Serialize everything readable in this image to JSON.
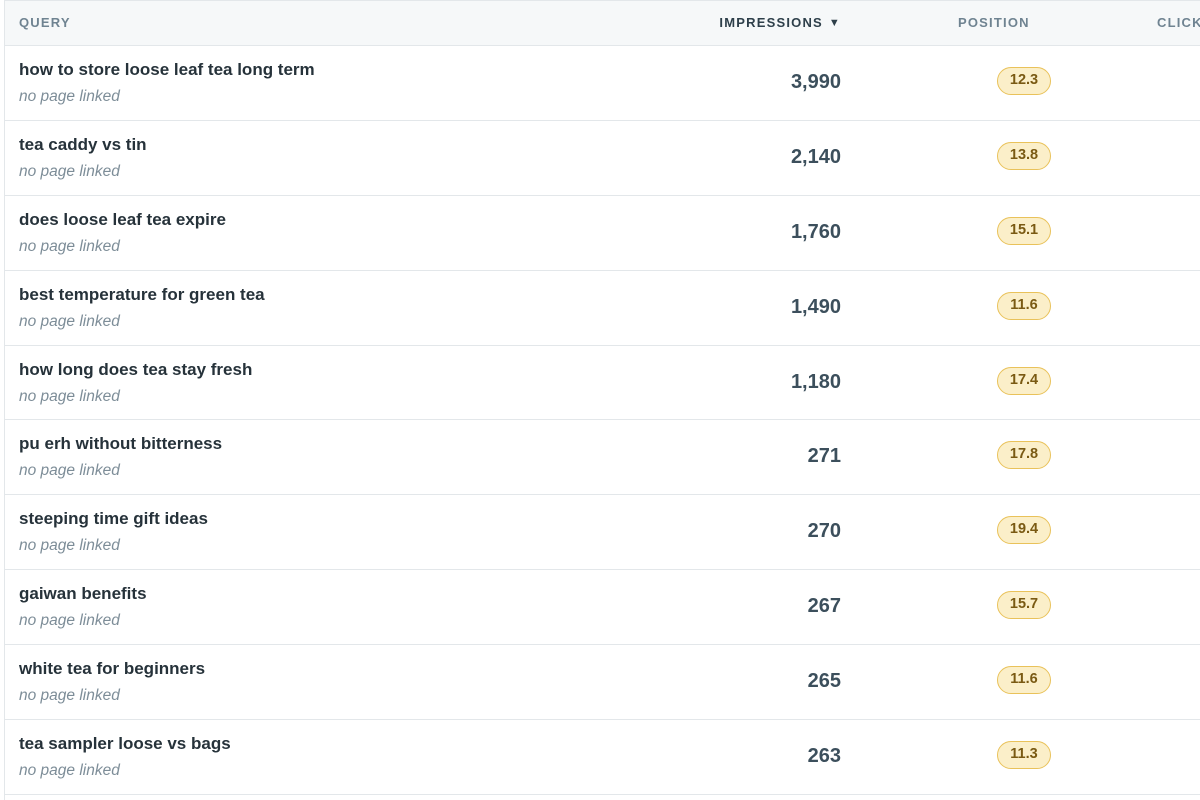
{
  "table": {
    "columns": {
      "query": "QUERY",
      "impressions": "IMPRESSIONS",
      "position": "POSITION",
      "clicks": "CLICK"
    },
    "sort_icon": "▼",
    "rows": [
      {
        "query": "how to store loose leaf tea long term",
        "page": "no page linked",
        "impressions": "3,990",
        "position": "12.3"
      },
      {
        "query": "tea caddy vs tin",
        "page": "no page linked",
        "impressions": "2,140",
        "position": "13.8"
      },
      {
        "query": "does loose leaf tea expire",
        "page": "no page linked",
        "impressions": "1,760",
        "position": "15.1"
      },
      {
        "query": "best temperature for green tea",
        "page": "no page linked",
        "impressions": "1,490",
        "position": "11.6"
      },
      {
        "query": "how long does tea stay fresh",
        "page": "no page linked",
        "impressions": "1,180",
        "position": "17.4"
      },
      {
        "query": "pu erh without bitterness",
        "page": "no page linked",
        "impressions": "271",
        "position": "17.8"
      },
      {
        "query": "steeping time gift ideas",
        "page": "no page linked",
        "impressions": "270",
        "position": "19.4"
      },
      {
        "query": "gaiwan benefits",
        "page": "no page linked",
        "impressions": "267",
        "position": "15.7"
      },
      {
        "query": "white tea for beginners",
        "page": "no page linked",
        "impressions": "265",
        "position": "11.6"
      },
      {
        "query": "tea sampler loose vs bags",
        "page": "no page linked",
        "impressions": "263",
        "position": "11.3"
      }
    ]
  },
  "colors": {
    "header_bg": "#f6f8f9",
    "badge_bg": "#fbefc9",
    "badge_border": "#e9c25a",
    "badge_text": "#7a5a13"
  }
}
